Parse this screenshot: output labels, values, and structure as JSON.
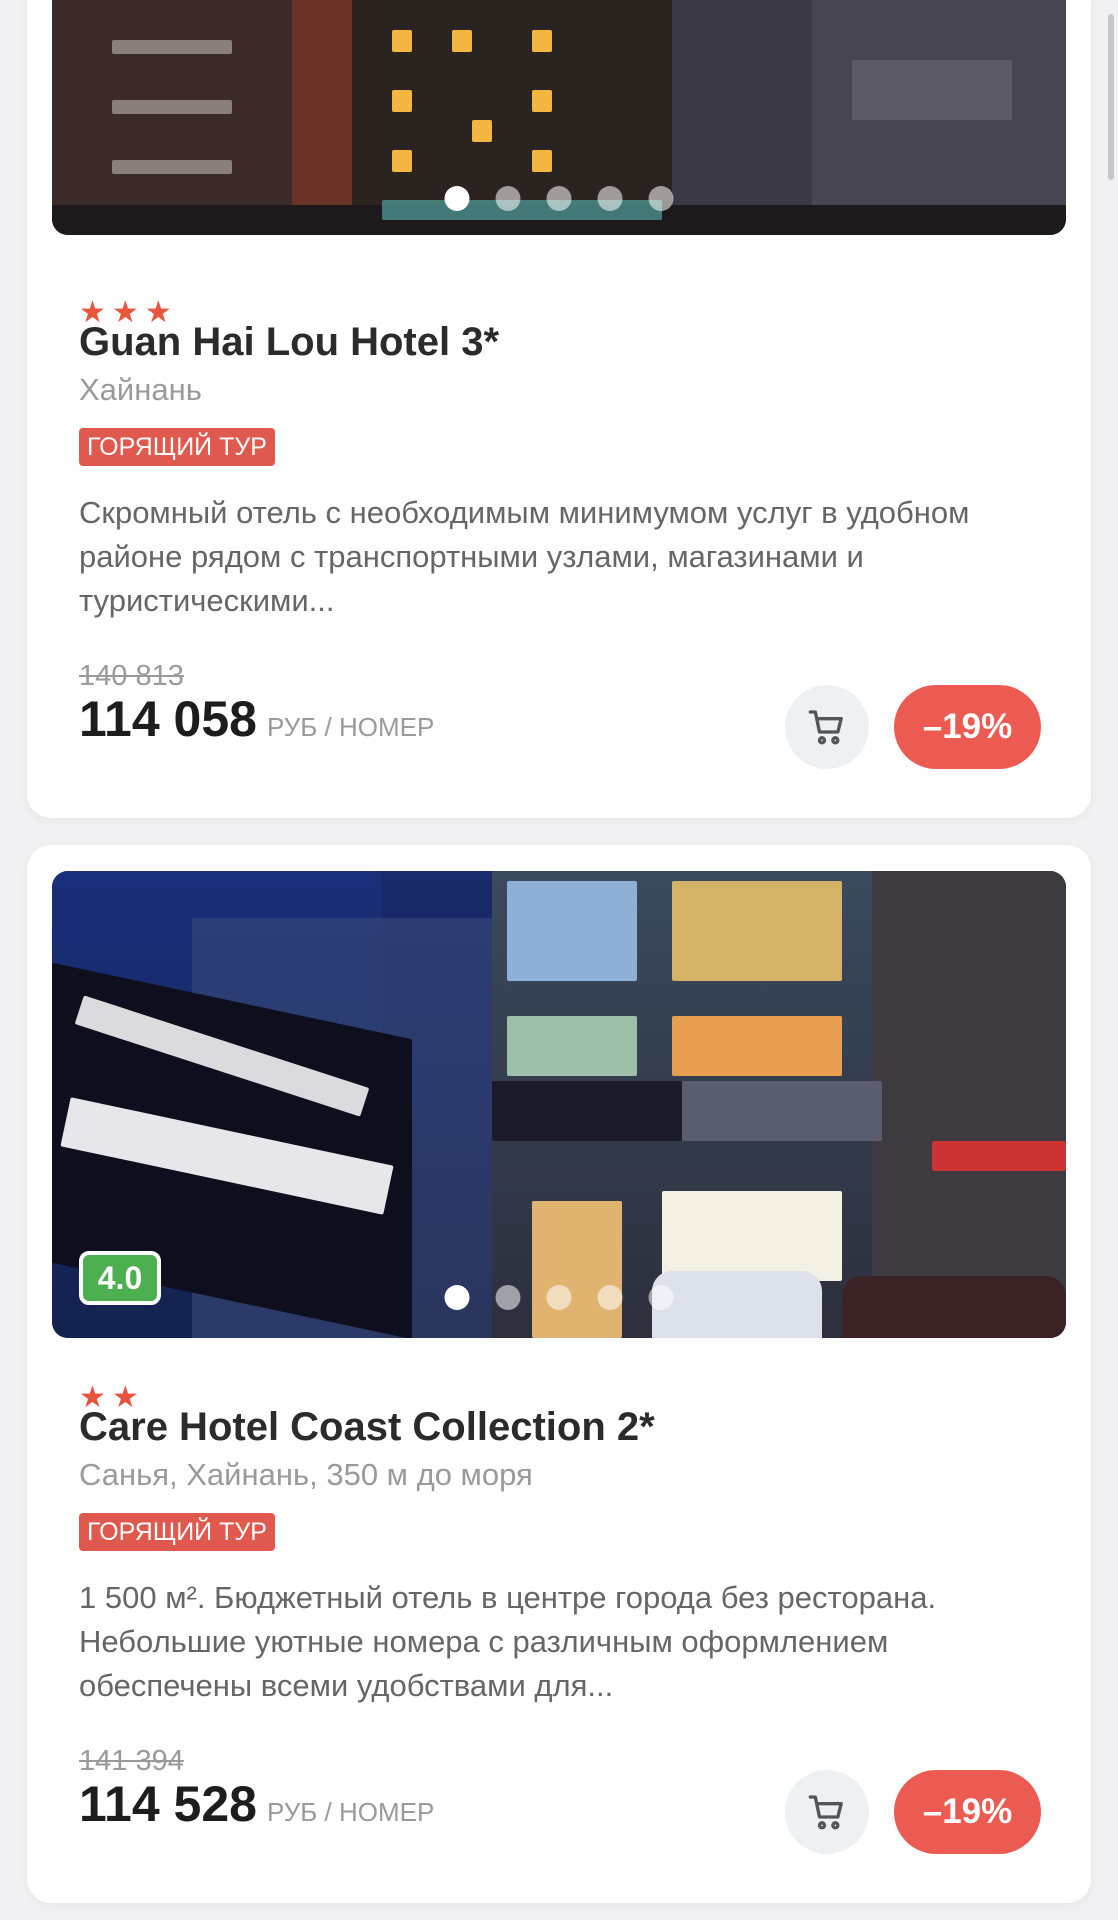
{
  "hotels": [
    {
      "stars": 3,
      "name": "Guan Hai Lou Hotel 3*",
      "location": "Хайнань",
      "hot_badge": "ГОРЯЩИЙ ТУР",
      "description": "Скромный отель с необходимым минимумом услуг в удобном районе рядом с транспортными узлами, магазинами и туристическими...",
      "old_price": "140 813",
      "price": "114 058",
      "price_unit": "РУБ / НОМЕР",
      "discount": "–19%",
      "photo_count": 5,
      "active_photo": 0
    },
    {
      "stars": 2,
      "name": "Care Hotel Coast Collection 2*",
      "location": "Санья, Хайнань, 350 м до моря",
      "hot_badge": "ГОРЯЩИЙ ТУР",
      "rating": "4.0",
      "description": "1 500 м². Бюджетный отель в центре города без ресторана. Небольшие уютные номера с различным оформлением обеспечены всеми удобствами для...",
      "old_price": "141 394",
      "price": "114 528",
      "price_unit": "РУБ / НОМЕР",
      "discount": "–19%",
      "photo_count": 5,
      "active_photo": 0
    }
  ],
  "colors": {
    "accent": "#ec5b52",
    "rating_green": "#4caf50",
    "star": "#e8553e"
  },
  "icons": [
    "cart-icon",
    "star-icon"
  ]
}
